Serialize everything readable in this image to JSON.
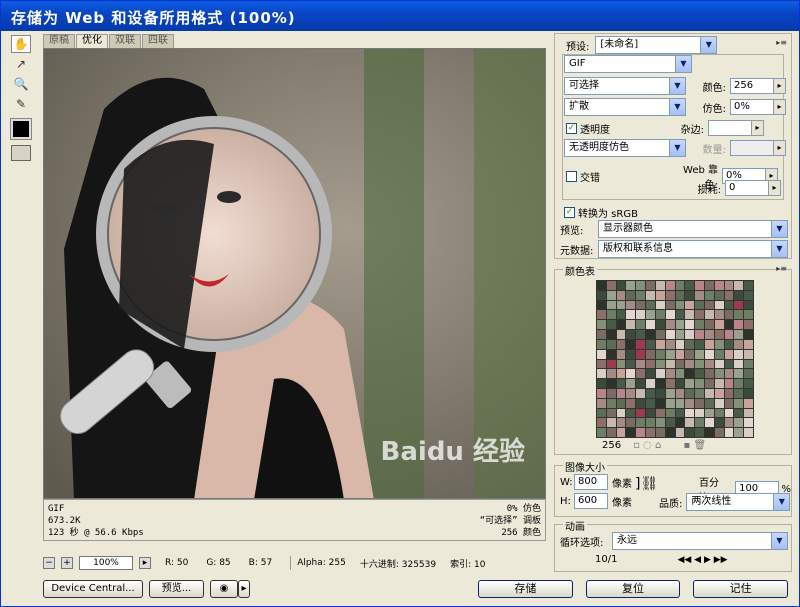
{
  "title": "存储为 Web 和设备所用格式 (100%)",
  "tabs": [
    "原稿",
    "优化",
    "双联",
    "四联"
  ],
  "info_left": [
    "GIF",
    "673.2K",
    "123 秒 @ 56.6 Kbps"
  ],
  "info_right": [
    "0% 仿色",
    "“可选择” 调板",
    "256 颜色"
  ],
  "status": {
    "zoom": "100%",
    "r": "R: 50",
    "g": "G: 85",
    "b": "B: 57",
    "alpha": "Alpha: 255",
    "hex": "十六进制: 325539",
    "index": "索引: 10"
  },
  "buttons_left": [
    "Device Central...",
    "预览..."
  ],
  "buttons_right": [
    "存储",
    "复位",
    "记住"
  ],
  "preset": {
    "label": "预设:",
    "value": "[未命名]"
  },
  "format": "GIF",
  "reduction": "可选择",
  "dither_algo": "扩散",
  "transparency": {
    "label": "透明度",
    "checked": true
  },
  "matte_dither": "无透明度仿色",
  "interlaced": {
    "label": "交错",
    "checked": false
  },
  "fields": {
    "colors": {
      "label": "颜色:",
      "value": "256"
    },
    "dither": {
      "label": "仿色:",
      "value": "0%"
    },
    "matte": {
      "label": "杂边:",
      "value": ""
    },
    "amount": {
      "label": "数量:",
      "value": ""
    },
    "websnap": {
      "label": "Web 靠色:",
      "value": "0%"
    },
    "lossy": {
      "label": "损耗:",
      "value": "0"
    }
  },
  "convert_srgb": {
    "label": "转换为 sRGB",
    "checked": true
  },
  "preview": {
    "label": "预览:",
    "value": "显示器颜色"
  },
  "metadata": {
    "label": "元数据:",
    "value": "版权和联系信息"
  },
  "color_table": {
    "title": "颜色表",
    "count": "256"
  },
  "image_size": {
    "title": "图像大小",
    "w_label": "W:",
    "w": "800",
    "h_label": "H:",
    "h": "600",
    "unit": "像素",
    "percent_label": "百分比:",
    "percent": "100",
    "percent_unit": "%",
    "quality_label": "品质:",
    "quality": "两次线性"
  },
  "animation": {
    "title": "动画",
    "loop_label": "循环选项:",
    "loop": "永远",
    "frame": "10/1"
  },
  "watermark": "Baidu 经验",
  "colors_theme": {
    "accent": "#0a5fe0",
    "panel": "#ece9d8"
  }
}
